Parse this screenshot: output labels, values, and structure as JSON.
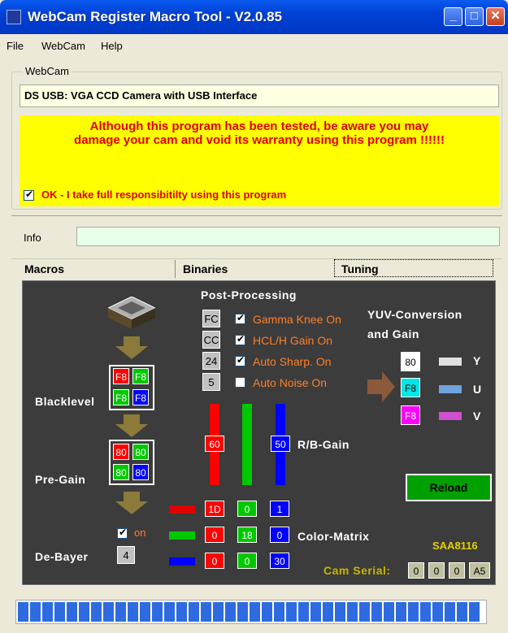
{
  "window": {
    "title": "WebCam Register Macro Tool - V2.0.85"
  },
  "menu": [
    "File",
    "WebCam",
    "Help"
  ],
  "webcam": {
    "legend": "WebCam",
    "device": "DS USB: VGA CCD Camera with USB Interface",
    "warning_line1": "Although this program has been tested, be aware you may",
    "warning_line2": "damage your cam and void its warranty using this program !!!!!!",
    "accept_label": "OK - I take full responsibitilty using this program",
    "accept_checked": true
  },
  "info": {
    "label": "Info",
    "value": ""
  },
  "tabs": [
    "Macros",
    "Binaries",
    "Tuning"
  ],
  "tuning": {
    "blacklevel": {
      "label": "Blacklevel",
      "values": [
        "F8",
        "F8",
        "F8",
        "F8"
      ]
    },
    "pregain": {
      "label": "Pre-Gain",
      "values": [
        "80",
        "80",
        "80",
        "80"
      ]
    },
    "debayer": {
      "label": "De-Bayer",
      "on_label": "on",
      "value": "4"
    },
    "postprocessing": {
      "title": "Post-Processing",
      "items": [
        {
          "value": "FC",
          "label": "Gamma Knee On",
          "checked": true
        },
        {
          "value": "CC",
          "label": "HCL/H Gain On",
          "checked": true
        },
        {
          "value": "24",
          "label": "Auto Sharp. On",
          "checked": true
        },
        {
          "value": "5",
          "label": "Auto Noise On",
          "checked": false
        }
      ]
    },
    "rbgain": {
      "label": "R/B-Gain",
      "red": "60",
      "blue": "50"
    },
    "yuv": {
      "title_line1": "YUV-Conversion",
      "title_line2": "and Gain",
      "y": "80",
      "u": "F8",
      "v": "F8",
      "y_label": "Y",
      "u_label": "U",
      "v_label": "V"
    },
    "reload_label": "Reload",
    "chip": "SAA8116",
    "color_matrix": {
      "label": "Color-Matrix",
      "rows": [
        [
          "1D",
          "0",
          "1"
        ],
        [
          "0",
          "18",
          "0"
        ],
        [
          "0",
          "0",
          "30"
        ]
      ]
    },
    "cam_serial": {
      "label": "Cam Serial:",
      "values": [
        "0",
        "0",
        "0",
        "A5"
      ]
    }
  },
  "colors": {
    "titlebar": "#0041D5",
    "warning_bg": "#FFFF00",
    "warning_text": "#E00000",
    "panel_bg": "#3C3C3C",
    "reload_bg": "#00A000"
  }
}
